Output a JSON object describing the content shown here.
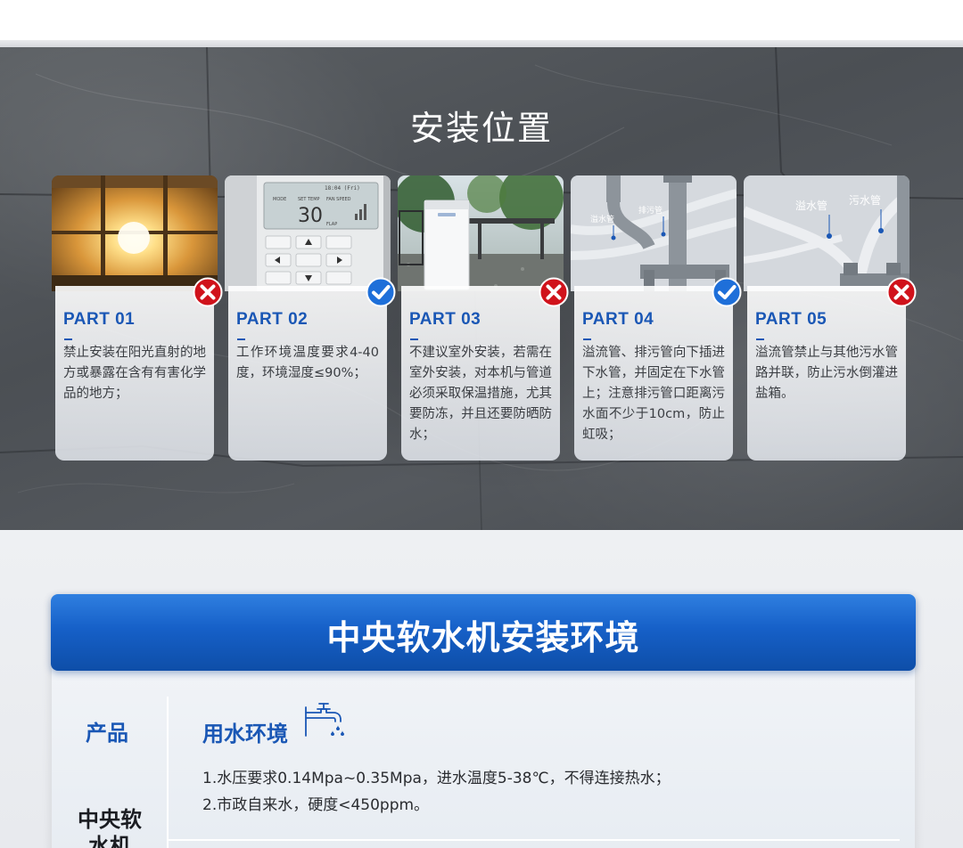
{
  "install_location": {
    "title": "安装位置",
    "cards": [
      {
        "part": "PART 01",
        "text": "禁止安装在阳光直射的地方或暴露在含有有害化学品的地方；",
        "status": "prohibited",
        "photo": "sunlight-window"
      },
      {
        "part": "PART 02",
        "text": "工作环境温度要求4-40度，环境湿度≤90%；",
        "status": "allowed",
        "photo": "thermostat-panel",
        "photo_text": {
          "temp_value": "30",
          "set_temp": "SET TEMP",
          "fan_speed": "FAN SPEED",
          "mode": "MODE",
          "flap": "FLAP",
          "clock": "18:04 (Fri)"
        }
      },
      {
        "part": "PART 03",
        "text": "不建议室外安装，若需在室外安装，对本机与管道必须采取保温措施，尤其要防冻，并且还要防晒防水；",
        "status": "prohibited",
        "photo": "outdoor-unit"
      },
      {
        "part": "PART 04",
        "text": "溢流管、排污管向下插进下水管，并固定在下水管上；注意排污管口距离污水面不少于10cm，防止虹吸；",
        "status": "allowed",
        "photo": "drain-pipes",
        "photo_text": {
          "label_a": "溢水管",
          "label_b": "排污管"
        }
      },
      {
        "part": "PART 05",
        "text": "溢流管禁止与其他污水管路并联，防止污水倒灌进盐箱。",
        "status": "prohibited",
        "photo": "sewage-pipes",
        "photo_text": {
          "label_a": "溢水管",
          "label_b": "污水管"
        }
      }
    ]
  },
  "environment": {
    "banner_title": "中央软水机安装环境",
    "product_label": "产品",
    "product_name": "中央软水机",
    "env_label": "用水环境",
    "env_icon": "faucet-icon",
    "lines": [
      "1.水压要求0.14Mpa~0.35Mpa，进水温度5-38℃，不得连接热水；",
      "2.市政自来水，硬度<450ppm。"
    ]
  },
  "colors": {
    "accent_blue": "#1a57b5",
    "banner_blue": "#1660c8",
    "prohibited_red": "#d0121b",
    "allowed_blue": "#1e6fd9"
  }
}
